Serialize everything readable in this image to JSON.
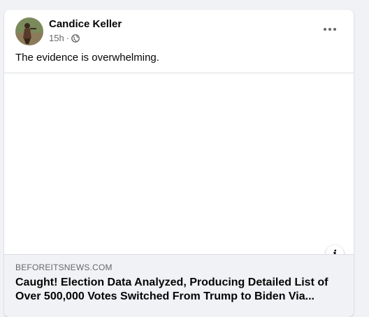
{
  "post": {
    "author": "Candice Keller",
    "timestamp": "15h",
    "separator": "·",
    "privacy_icon": "globe-icon",
    "more_icon": "more-horizontal-icon",
    "text": "The evidence is overwhelming."
  },
  "link_preview": {
    "domain": "BEFOREITSNEWS.COM",
    "title_line1": "Caught! Election Data Analyzed, Producing Detailed List of",
    "title_line2": "Over 500,000 Votes Switched From Trump to Biden Via...",
    "info_icon": "info-icon",
    "info_glyph": "i"
  },
  "colors": {
    "background": "#f0f2f5",
    "card": "#ffffff",
    "primary_text": "#050505",
    "secondary_text": "#65676b",
    "divider": "#dadde1"
  }
}
